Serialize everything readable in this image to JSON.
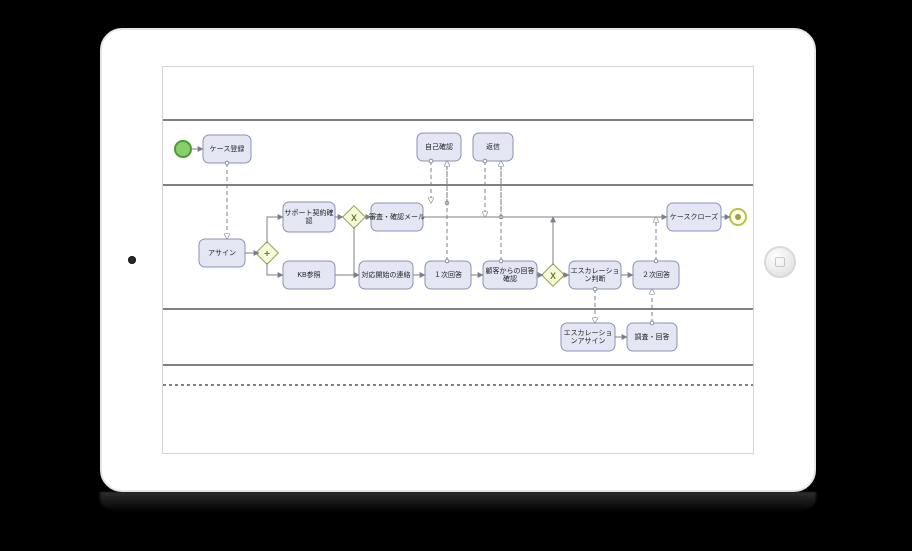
{
  "domain": "Diagram",
  "device": "tablet-landscape",
  "diagram": {
    "type": "BPMN",
    "lanes": [
      {
        "id": "lane1",
        "label": ""
      },
      {
        "id": "lane2",
        "label": ""
      },
      {
        "id": "lane3",
        "label": ""
      }
    ],
    "events": {
      "start": {
        "type": "start",
        "lane": "lane1"
      },
      "end": {
        "type": "end",
        "lane": "lane2"
      }
    },
    "gateways": {
      "gw_parallel": {
        "type": "parallel",
        "marker": "+",
        "lane": "lane2"
      },
      "gw_xor1": {
        "type": "exclusive",
        "marker": "X",
        "lane": "lane2"
      },
      "gw_xor2": {
        "type": "exclusive",
        "marker": "X",
        "lane": "lane2"
      }
    },
    "tasks": {
      "case_register": "ケース登録",
      "assign": "アサイン",
      "support_contract": "サポート契約確認",
      "kb_search": "KB参照",
      "review_mail": "審査・確認メール",
      "notify_start": "対応開始の連絡",
      "first_answer": "１次回答",
      "customer_reply": "顧客からの回答確認",
      "self_confirm": "自己確認",
      "return_task": "返信",
      "escalation_judge": "エスカレーション判断",
      "second_answer": "２次回答",
      "escalation_assign": "エスカレーションアサイン",
      "investigate": "調査・回答",
      "case_close": "ケースクローズ"
    }
  }
}
